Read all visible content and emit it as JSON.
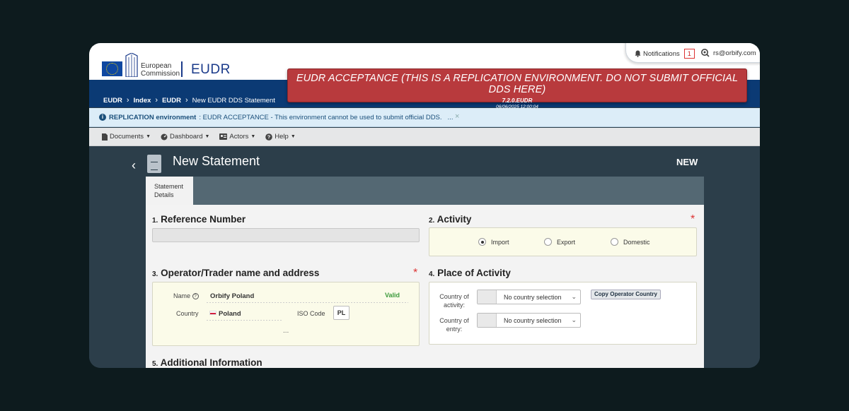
{
  "header": {
    "logo_line1": "European",
    "logo_line2": "Commission",
    "app_title": "EUDR",
    "notifications_label": "Notifications",
    "notifications_count": "1",
    "user_email": "rs@orbify.com"
  },
  "env_banner": {
    "title": "EUDR ACCEPTANCE (THIS IS A REPLICATION ENVIRONMENT. DO NOT SUBMIT OFFICIAL DDS HERE)",
    "version": "7.2.0.EUDR",
    "timestamp": "06/06/2025 12:00:04"
  },
  "breadcrumb": {
    "items": [
      "EUDR",
      "Index",
      "EUDR",
      "New EUDR DDS Statement"
    ]
  },
  "info_bar": {
    "label_bold": "REPLICATION environment",
    "message": ": EUDR ACCEPTANCE - This environment cannot be used to submit official DDS.",
    "more": "...",
    "close": "×"
  },
  "menu": {
    "items": [
      "Documents",
      "Dashboard",
      "Actors",
      "Help"
    ]
  },
  "page": {
    "title": "New Statement",
    "status": "NEW",
    "tab_line1": "Statement",
    "tab_line2": "Details"
  },
  "sections": {
    "reference": {
      "num": "1.",
      "title": "Reference Number",
      "value": ""
    },
    "activity": {
      "num": "2.",
      "title": "Activity",
      "required": "*",
      "options": [
        "Import",
        "Export",
        "Domestic"
      ],
      "selected": "Import"
    },
    "operator": {
      "num": "3.",
      "title": "Operator/Trader name and address",
      "required": "*",
      "name_label": "Name",
      "name_value": "Orbify Poland",
      "valid_label": "Valid",
      "country_label": "Country",
      "country_value": "Poland",
      "iso_label": "ISO Code",
      "iso_value": "PL",
      "more": "..."
    },
    "place": {
      "num": "4.",
      "title": "Place of Activity",
      "country_activity_label_1": "Country of",
      "country_activity_label_2": "activity:",
      "country_activity_value": "No country selection",
      "copy_button": "Copy Operator Country",
      "country_entry_label_1": "Country of",
      "country_entry_label_2": "entry:",
      "country_entry_value": "No country selection"
    },
    "additional": {
      "num": "5.",
      "title": "Additional Information"
    }
  },
  "colors": {
    "banner": "#b83a3d",
    "header_blue": "#0b3a74",
    "dark_bg": "#2c3e4a",
    "valid_green": "#3c9a3c",
    "required_red": "#d33333"
  }
}
